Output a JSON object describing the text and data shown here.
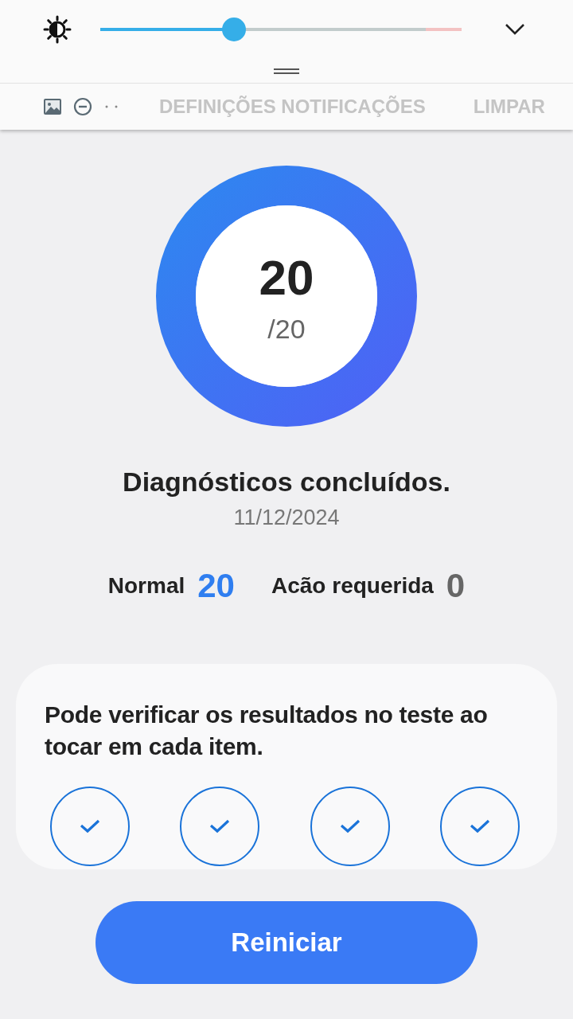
{
  "quick_panel": {
    "brightness": {
      "level": 0.37
    },
    "buttons": [
      {
        "label": "DEFINIÇÕES NOTIFICAÇÕES"
      },
      {
        "label": "LIMPAR"
      }
    ]
  },
  "score": {
    "value": "20",
    "total": "/20"
  },
  "status": {
    "title": "Diagnósticos concluídos.",
    "date": "11/12/2024"
  },
  "summary": [
    {
      "kind": "normal",
      "label": "Normal",
      "count": "20"
    },
    {
      "kind": "action",
      "label": "Acão requerida",
      "count": "0"
    }
  ],
  "card": {
    "text": "Pode verificar os resultados no teste ao tocar em cada item.",
    "items": [
      {
        "checked": true
      },
      {
        "checked": true
      },
      {
        "checked": true
      },
      {
        "checked": true
      }
    ]
  },
  "button": {
    "label": "Reiniciar"
  }
}
